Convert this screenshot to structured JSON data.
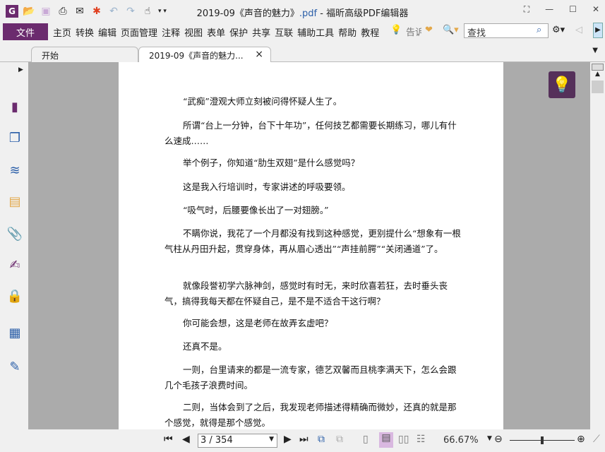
{
  "window": {
    "title_prefix": "2019-09《声音的魅力》",
    "title_ext": ".pdf",
    "title_suffix": " - 福昕高级PDF编辑器",
    "controls": [
      "⛶",
      "—",
      "☐",
      "✕"
    ]
  },
  "quick_access": {
    "logo": "G",
    "icons": [
      "folder-open-icon",
      "save-icon",
      "print-icon",
      "email-icon",
      "new-icon",
      "undo-icon",
      "redo-icon",
      "hand-tool-icon"
    ]
  },
  "menu": {
    "file": "文件",
    "items": [
      "主页",
      "转换",
      "编辑",
      "页面管理",
      "注释",
      "视图",
      "表单",
      "保护",
      "共享",
      "互联",
      "辅助工具",
      "帮助",
      "教程"
    ],
    "tell": "告诉"
  },
  "search": {
    "placeholder": "查找"
  },
  "tabs": [
    {
      "label": "开始"
    },
    {
      "label": "2019-09《声音的魅力...",
      "close": "×"
    }
  ],
  "document": {
    "paragraphs": [
      "“武痴”澄观大师立刻被问得怀疑人生了。",
      "所谓“台上一分钟，台下十年功”，任何技艺都需要长期练习，哪儿有什么速成……",
      "举个例子，你知道“肋生双翅”是什么感觉吗？",
      "这是我入行培训时，专家讲述的呼吸要领。",
      "“吸气时，后腰要像长出了一对翅膀。”",
      "不瞒你说，我花了一个月都没有找到这种感觉，更别提什么“想象有一根气柱从丹田升起，贯穿身体，再从眉心透出”“声挂前腭”“关闭通道”了。",
      "就像段誉初学六脉神剑，感觉时有时无，来时欣喜若狂，去时垂头丧气，搞得我每天都在怀疑自己，是不是不适合干这行啊？",
      "你可能会想，这是老师在故弄玄虚吧？",
      "还真不是。",
      "一则，台里请来的都是一流专家，德艺双馨而且桃李满天下，怎么会跟几个毛孩子浪费时间。",
      "二则，当体会到了之后，我发现老师描述得精确而微妙，还真的就是那个感觉，就得是那个感觉。"
    ]
  },
  "status": {
    "page": "3 / 354",
    "zoom": "66.67%",
    "zoom_fraction": 0.5
  },
  "colors": {
    "accent": "#6b2b6e",
    "viewer_bg": "#ababab"
  }
}
